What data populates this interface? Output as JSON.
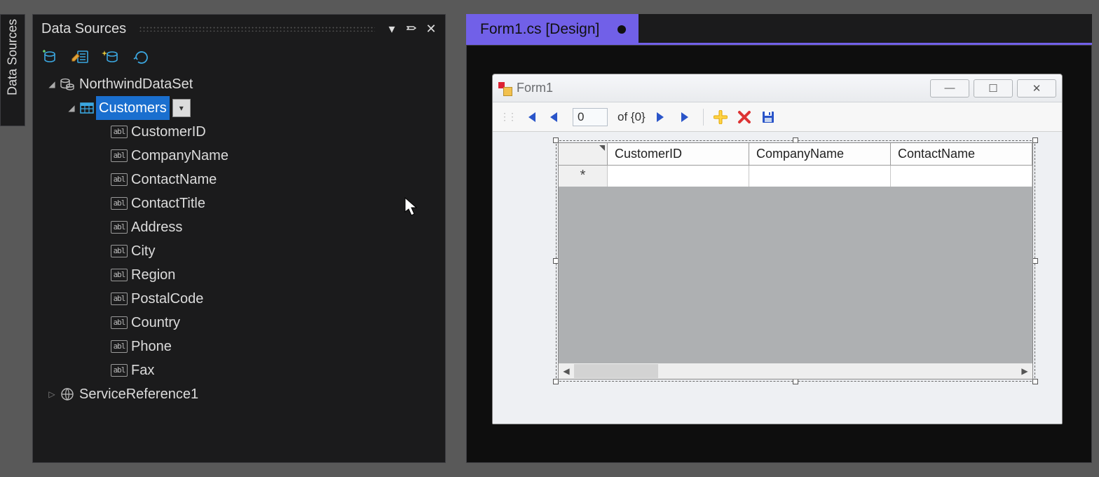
{
  "sideTabTitle": "Data Sources",
  "panel": {
    "title": "Data Sources"
  },
  "tree": {
    "dataset": "NorthwindDataSet",
    "table": "Customers",
    "columns": [
      "CustomerID",
      "CompanyName",
      "ContactName",
      "ContactTitle",
      "Address",
      "City",
      "Region",
      "PostalCode",
      "Country",
      "Phone",
      "Fax"
    ],
    "serviceRef": "ServiceReference1"
  },
  "tab": {
    "title": "Form1.cs [Design]"
  },
  "form": {
    "title": "Form1",
    "nav": {
      "position": "0",
      "ofText": "of {0}"
    },
    "grid": {
      "columns": [
        "CustomerID",
        "CompanyName",
        "ContactName"
      ],
      "newRowMarker": "*"
    }
  }
}
